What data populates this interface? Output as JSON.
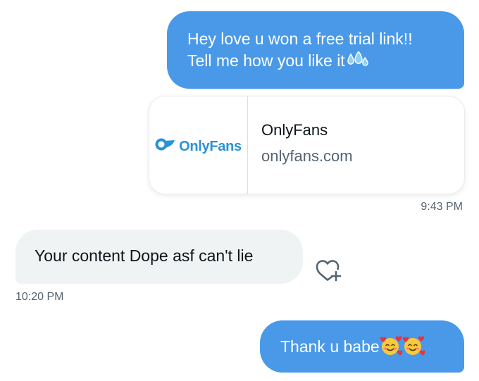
{
  "messages": [
    {
      "direction": "sent",
      "lines": [
        "Hey love u won a free trial link!!",
        "Tell me how you like it"
      ],
      "trailing_icon": "sweat-droplets-icon"
    },
    {
      "direction": "received",
      "text": "Your content Dope asf can't lie"
    },
    {
      "direction": "sent",
      "text": "Thank u babe",
      "trailing_icons": [
        "smiling-face-with-hearts-icon",
        "smiling-face-with-hearts-icon"
      ]
    }
  ],
  "link_card": {
    "logo_text": "OnlyFans",
    "logo_icon": "onlyfans-logo-icon",
    "title": "OnlyFans",
    "domain": "onlyfans.com"
  },
  "timestamps": [
    "9:43 PM",
    "10:20 PM"
  ],
  "colors": {
    "sent_bubble": "#4a99e9",
    "received_bubble": "#eff3f4",
    "brand_blue": "#2b92d6",
    "secondary_text": "#536471"
  }
}
